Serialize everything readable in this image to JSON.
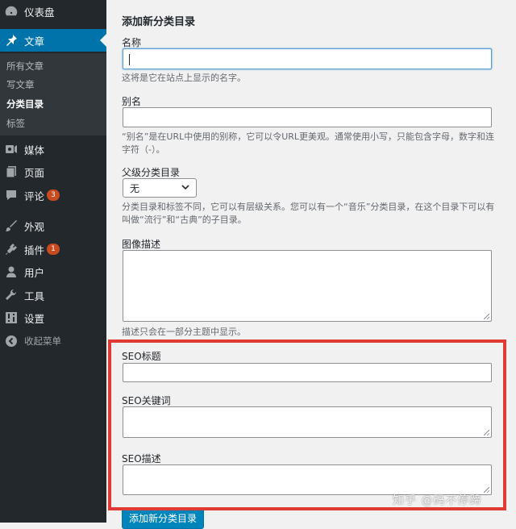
{
  "sidebar": {
    "items": [
      {
        "label": "仪表盘",
        "icon": "dashboard-icon"
      },
      {
        "label": "文章",
        "icon": "pushpin-icon"
      },
      {
        "label": "媒体",
        "icon": "media-icon"
      },
      {
        "label": "页面",
        "icon": "page-icon"
      },
      {
        "label": "评论",
        "icon": "comment-icon",
        "badge": "3"
      },
      {
        "label": "外观",
        "icon": "appearance-icon"
      },
      {
        "label": "插件",
        "icon": "plugin-icon",
        "badge": "1"
      },
      {
        "label": "用户",
        "icon": "user-icon"
      },
      {
        "label": "工具",
        "icon": "wrench-icon"
      },
      {
        "label": "设置",
        "icon": "settings-icon"
      },
      {
        "label": "收起菜单",
        "icon": "collapse-icon"
      }
    ],
    "submenu": [
      "所有文章",
      "写文章",
      "分类目录",
      "标签"
    ],
    "active_item": "文章",
    "current_submenu": "分类目录"
  },
  "form": {
    "heading": "添加新分类目录",
    "name_label": "名称",
    "name_value": "",
    "name_desc": "这将是它在站点上显示的名字。",
    "slug_label": "别名",
    "slug_value": "",
    "slug_desc": "“别名”是在URL中使用的别称，它可以令URL更美观。通常使用小写，只能包含字母，数字和连字符（-）。",
    "parent_label": "父级分类目录",
    "parent_selected": "无",
    "parent_desc": "分类目录和标签不同，它可以有层级关系。您可以有一个“音乐”分类目录，在这个目录下可以有叫做“流行”和“古典”的子目录。",
    "image_desc_label": "图像描述",
    "image_desc_value": "",
    "image_desc_help": "描述只会在一部分主题中显示。",
    "seo_title_label": "SEO标题",
    "seo_keywords_label": "SEO关键词",
    "seo_description_label": "SEO描述",
    "submit_label": "添加新分类目录"
  },
  "watermark": "知乎 @码不停蹄",
  "colors": {
    "sidebar_bg": "#23282d",
    "active_blue": "#0073aa",
    "highlight_red": "#e03a35",
    "badge_orange": "#ca4a1f"
  }
}
